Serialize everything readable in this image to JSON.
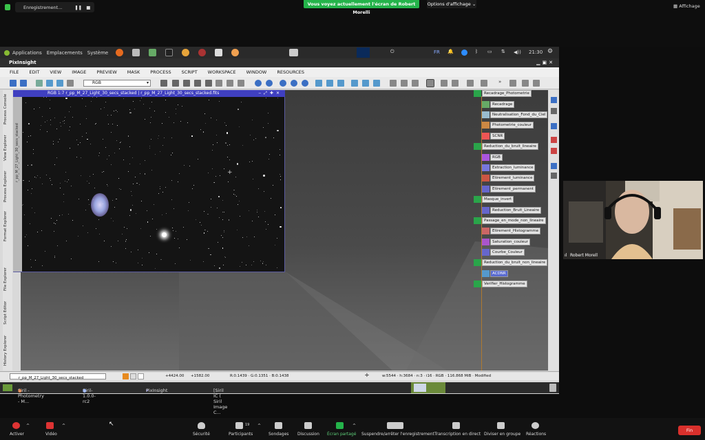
{
  "zoom_top": {
    "recording_label": "Enregistrement...",
    "banner": "Vous voyez actuellement l'écran de Robert Morelli",
    "view_options": "Options d'affichage ⌄",
    "display_label": "Affichage"
  },
  "gnome": {
    "applications": "Applications",
    "places": "Emplacements",
    "system": "Système",
    "lang": "FR",
    "volume": "◀))",
    "clock": "21:30"
  },
  "pixinsight": {
    "title": "PixInsight",
    "menu": [
      "FILE",
      "EDIT",
      "VIEW",
      "IMAGE",
      "PREVIEW",
      "MASK",
      "PROCESS",
      "SCRIPT",
      "WORKSPACE",
      "WINDOW",
      "RESOURCES"
    ],
    "rgb_select": "RGB",
    "side_tabs": [
      "Process Console",
      "View Explorer",
      "Process Explorer",
      "Format Explorer",
      "File Explorer",
      "Script Editor",
      "History Explorer"
    ],
    "image_window_title": "RGB 1:7 r_pp_M_27_Light_30_secs_stacked | r_pp_M_27_Light_30_secs_stacked.fits",
    "image_side_label": "r_pp_M_27_Light_30_secs_stacked",
    "icons": [
      {
        "label": "Recadrage_Photometrie",
        "type": "process"
      },
      {
        "label": "Recadrage",
        "type": "icon"
      },
      {
        "label": "Neutralisation_Fond_du_Ciel",
        "type": "icon"
      },
      {
        "label": "Photometrie_couleur",
        "type": "icon"
      },
      {
        "label": "SCNR",
        "type": "icon"
      },
      {
        "label": "Reduction_du_bruit_lineaire",
        "type": "process"
      },
      {
        "label": "RGB",
        "type": "icon"
      },
      {
        "label": "Extraction_luminance",
        "type": "icon"
      },
      {
        "label": "Etirement_luminance",
        "type": "icon"
      },
      {
        "label": "Etirement_permanent",
        "type": "icon"
      },
      {
        "label": "Masque_invert",
        "type": "process"
      },
      {
        "label": "Reduction_Bruit_Lineaire",
        "type": "icon"
      },
      {
        "label": "Passage_en_mode_non_lineaire",
        "type": "process"
      },
      {
        "label": "Etirement_Histogramme",
        "type": "icon"
      },
      {
        "label": "Saturation_couleur",
        "type": "icon"
      },
      {
        "label": "Courbe_Couleur",
        "type": "icon"
      },
      {
        "label": "Reduction_du_bruit_non_lineaire",
        "type": "process"
      },
      {
        "label": "ACDNR",
        "type": "icon"
      },
      {
        "label": "Verifier_Histogramme",
        "type": "process"
      }
    ],
    "status": {
      "view": "r_pp_M_27_Light_30_secs_stacked",
      "x": "+4424.00",
      "y": "+1582.00",
      "rgb": "R:0.1439 · G:0.1351 · B:0.1438",
      "info": "w:5544 · h:3684 · n:3 · i16 · RGB · 116.868 MiB · Modified"
    }
  },
  "taskbar": {
    "items": [
      "Siril - Photometry - M...",
      "Siril-1.0.0-rc2",
      "PixInsight",
      "[Siril IC ( Siril Image C..."
    ]
  },
  "participant": {
    "name": "Robert Morell"
  },
  "zoom_bottom": {
    "mute": "Activer",
    "video": "Vidéo",
    "security": "Sécurité",
    "participants": "Participants",
    "participants_count": "19",
    "polls": "Sondages",
    "chat": "Discussion",
    "share": "Écran partagé",
    "record": "Suspendre/arrêter l'enregistrement",
    "transcript": "Transcription en direct",
    "rooms": "Diviser en groupe",
    "reactions": "Réactions",
    "end": "Fin"
  }
}
